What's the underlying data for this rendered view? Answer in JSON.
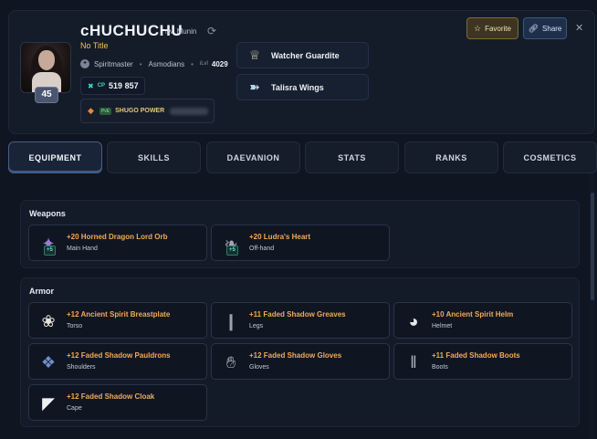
{
  "profile": {
    "name": "cHUCHUCHU",
    "server_region": "TW",
    "server_name": "Munin",
    "title": "No Title",
    "class": "Spiritmaster",
    "faction": "Asmodians",
    "ilvl_label": "iLvl",
    "ilvl": "4029",
    "level": "45",
    "cp_label": "CP",
    "cp": "519 857",
    "shugo_mode": "PvE",
    "shugo_label": "SHUGO POWER"
  },
  "mini_cards": [
    {
      "label": "Watcher Guardite",
      "icon": "guardite-icon"
    },
    {
      "label": "Talisra Wings",
      "icon": "wings-icon"
    }
  ],
  "actions": {
    "favorite": "Favorite",
    "share": "Share"
  },
  "tabs": [
    "EQUIPMENT",
    "SKILLS",
    "DAEVANION",
    "STATS",
    "RANKS",
    "COSMETICS"
  ],
  "weapons": {
    "title": "Weapons",
    "items": [
      {
        "name": "+20 Horned Dragon Lord Orb",
        "slot": "Main Hand",
        "badge": "+5"
      },
      {
        "name": "+20 Ludra's Heart",
        "slot": "Off-hand",
        "badge": "+5"
      }
    ]
  },
  "armor": {
    "title": "Armor",
    "items": [
      {
        "name": "+12 Ancient Spirit Breastplate",
        "slot": "Torso"
      },
      {
        "name": "+11 Faded Shadow Greaves",
        "slot": "Legs"
      },
      {
        "name": "+10 Ancient Spirit Helm",
        "slot": "Helmet"
      },
      {
        "name": "+12 Faded Shadow Pauldrons",
        "slot": "Shoulders"
      },
      {
        "name": "+12 Faded Shadow Gloves",
        "slot": "Gloves"
      },
      {
        "name": "+11 Faded Shadow Boots",
        "slot": "Boots"
      },
      {
        "name": "+12 Faded Shadow Cloak",
        "slot": "Cape"
      }
    ]
  },
  "colors": {
    "accent_gold": "#f3a955",
    "title_yellow": "#f0c34a",
    "cp_teal": "#3fd8c2"
  }
}
